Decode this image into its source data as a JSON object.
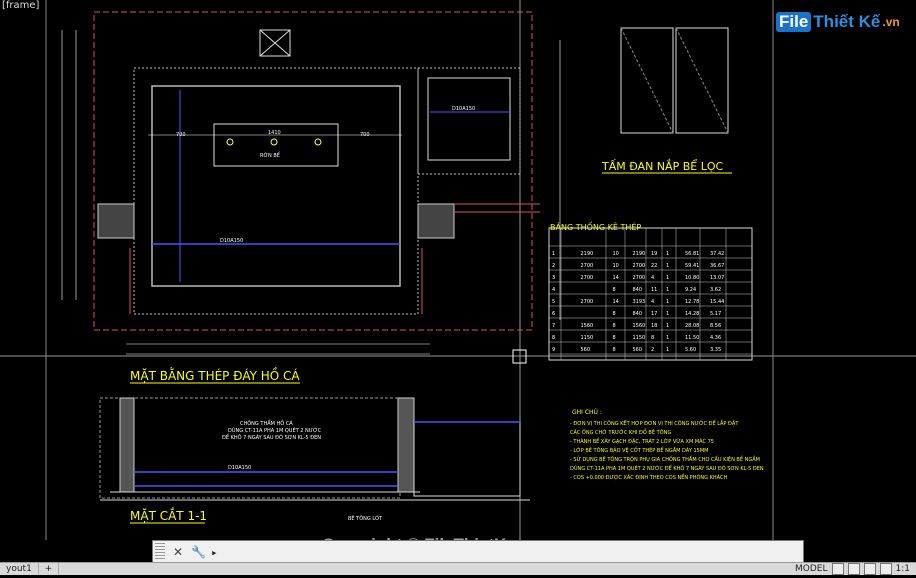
{
  "viewport": {
    "label": "[frame]"
  },
  "watermark": {
    "logo_main": "File",
    "logo_rest": "Thiết Kế",
    "logo_tld": ".vn",
    "copyright": "Copyright © FileThietKe.vn"
  },
  "drawing": {
    "plan_title": "MẶT BẰNG THÉP ĐÁY HỒ CÁ",
    "section_title": "MẶT CẮT 1-1",
    "cover_title": "TẤM ĐAN NẮP BỂ LỌC",
    "table_title": "BẢNG THỐNG KÊ THÉP",
    "notes_title": "GHI CHÚ :",
    "rebar_1": "D10A150",
    "rebar_2": "D10A150",
    "rebar_3": "D10A150",
    "label_ron": "RỜN BỂ",
    "dims": {
      "d700a": "700",
      "d1410": "1410",
      "d700b": "700",
      "d400": "400"
    },
    "section_note_1": "CHỐNG THẤM HỒ CÁ",
    "section_note_2": "DÙNG CT-11A PHA 1M QUÉT 2 NƯỚC",
    "section_note_3": "ĐỂ KHÔ 7 NGÀY SAU ĐÓ SƠN KL-5 ĐEN",
    "concrete_note": "BÊ TÔNG LÓT",
    "notes": [
      "- ĐƠN VỊ THI CÔNG KẾT HỢP ĐƠN VỊ THI CÔNG NƯỚC ĐỂ LẮP ĐẶT",
      "CÁC ỐNG CHỜ TRƯỚC KHI ĐỔ BÊ TÔNG",
      "- THÀNH BỂ XÂY GẠCH ĐẶC, TRÁT 2 LỚP VỮA XM MÁC 75",
      "- LỚP BÊ TÔNG BẢO VỆ CỐT THÉP BỂ NGẦM DÀY 15MM",
      "- SỬ DỤNG BÊ TÔNG TRỘN PHỤ GIA CHỐNG THẤM CHO CẤU KIỆN BỂ NGẦM",
      "DÙNG CT-11A PHA 1M QUÉT 2 NƯỚC ĐỂ KHÔ 7 NGÀY SAU ĐÓ SƠN KL-5 ĐEN",
      "- COS +0.000 ĐƯỢC XÁC ĐỊNH THEO COS NỀN PHÒNG KHÁCH"
    ],
    "table_rows": [
      [
        "1",
        "2190",
        "10",
        "2190",
        "19",
        "1",
        "56.81",
        "37.42"
      ],
      [
        "2",
        "2700",
        "10",
        "2700",
        "22",
        "1",
        "59.41",
        "36.67"
      ],
      [
        "3",
        "2700",
        "14",
        "2700",
        "4",
        "1",
        "10.80",
        "13.07"
      ],
      [
        "4",
        "",
        "8",
        "840",
        "11",
        "1",
        "9.24",
        "3.62"
      ],
      [
        "5",
        "2700",
        "14",
        "3193",
        "4",
        "1",
        "12.78",
        "15.44"
      ],
      [
        "6",
        "",
        "8",
        "840",
        "17",
        "1",
        "14.28",
        "5.17"
      ],
      [
        "7",
        "1560",
        "8",
        "1560",
        "18",
        "1",
        "28.08",
        "8.56"
      ],
      [
        "8",
        "1150",
        "8",
        "1150",
        "8",
        "1",
        "11.50",
        "4.36"
      ],
      [
        "9",
        "560",
        "8",
        "560",
        "2",
        "1",
        "5.60",
        "3.35"
      ]
    ]
  },
  "command": {
    "placeholder": "",
    "prompt": "▸"
  },
  "status": {
    "layout_tab": "yout1",
    "add_tab": "+",
    "model": "MODEL",
    "scale": "1:1"
  }
}
